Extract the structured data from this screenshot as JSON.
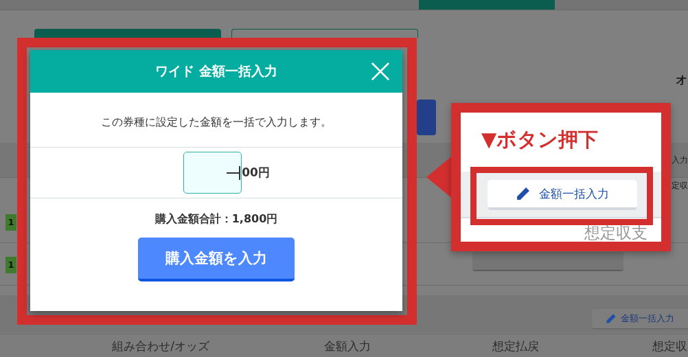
{
  "background_page": {
    "tabs": [
      {
        "selected": true
      },
      {
        "selected": false
      }
    ],
    "side_labels": [
      "オ",
      "入力",
      "定収"
    ],
    "row_badges": [
      "1",
      "1"
    ],
    "bulk_button": "金額一括入力",
    "columns": [
      "組み合わせ/オッズ",
      "金額入力",
      "想定払戻",
      "想定収"
    ]
  },
  "modal": {
    "title": "ワイド 金額一括入力",
    "description": "この券種に設定した金額を一括で入力します。",
    "amount_input": {
      "suffix": "00円"
    },
    "total": "購入金額合計：1,800円",
    "submit_button": "購入金額を入力"
  },
  "callout": {
    "heading": "▼ボタン押下",
    "button": "金額一括入力",
    "column_label": "想定収支"
  }
}
